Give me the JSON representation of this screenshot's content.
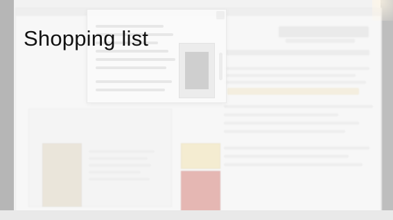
{
  "slide": {
    "title": "Shopping list"
  },
  "theme": {
    "background_hex": "#e2e2e2",
    "overlay_hex": "#ffffff"
  }
}
